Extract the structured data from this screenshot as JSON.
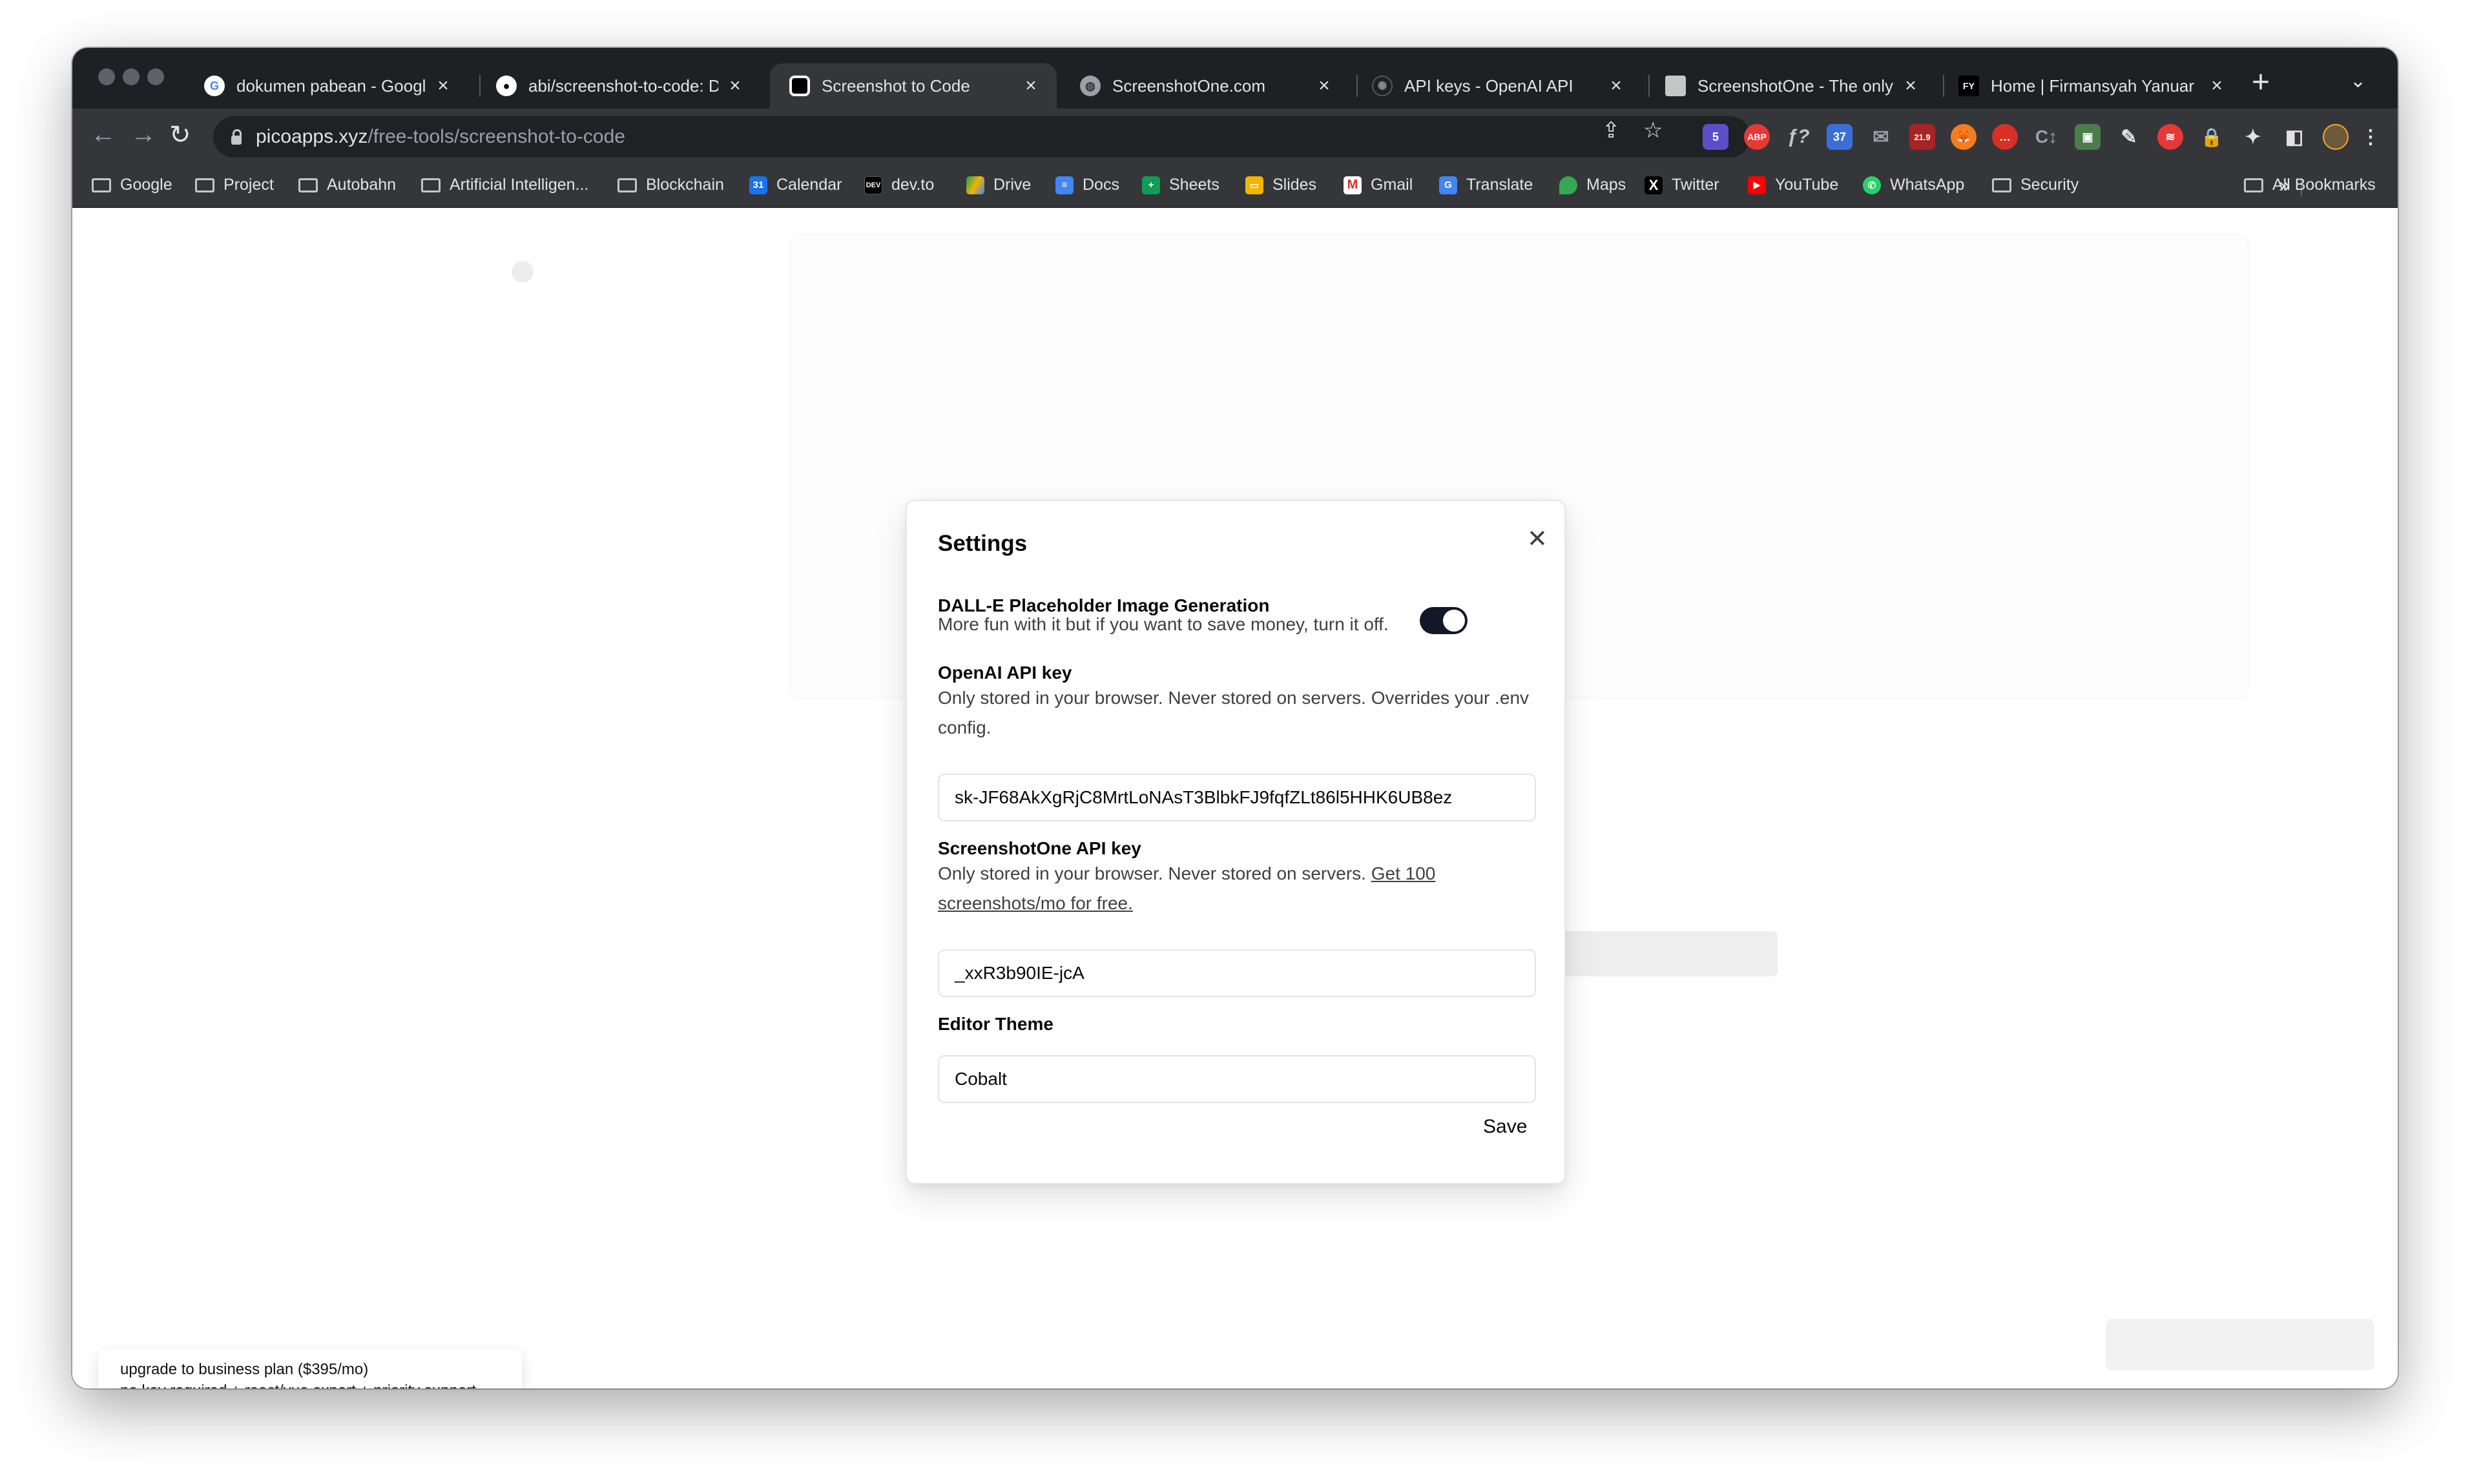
{
  "browser": {
    "tabs": [
      {
        "title": "dokumen pabean - Google S",
        "icon": "google-icon",
        "active": false
      },
      {
        "title": "abi/screenshot-to-code: Dr",
        "icon": "github-icon",
        "active": false
      },
      {
        "title": "Screenshot to Code",
        "icon": "app-icon",
        "active": true
      },
      {
        "title": "ScreenshotOne.com",
        "icon": "globe-icon",
        "active": false
      },
      {
        "title": "API keys - OpenAI API",
        "icon": "openai-icon",
        "active": false
      },
      {
        "title": "ScreenshotOne - The only c",
        "icon": "document-icon",
        "active": false
      },
      {
        "title": "Home | Firmansyah Yanuar",
        "icon": "fy-icon",
        "active": false
      }
    ],
    "url_host": "picoapps.xyz",
    "url_path": "/free-tools/screenshot-to-code",
    "extension_badges": {
      "ext1": "5",
      "abp": "ABP",
      "ext3": "37",
      "calendar": "21.9"
    }
  },
  "bookmarks": [
    {
      "label": "Google",
      "icon": "folder-icon"
    },
    {
      "label": "Project",
      "icon": "folder-icon"
    },
    {
      "label": "Autobahn",
      "icon": "folder-icon"
    },
    {
      "label": "Artificial Intelligen...",
      "icon": "folder-icon"
    },
    {
      "label": "Blockchain",
      "icon": "folder-icon"
    },
    {
      "label": "Calendar",
      "icon": "calendar-icon"
    },
    {
      "label": "dev.to",
      "icon": "dev-icon"
    },
    {
      "label": "Drive",
      "icon": "drive-icon"
    },
    {
      "label": "Docs",
      "icon": "docs-icon"
    },
    {
      "label": "Sheets",
      "icon": "sheets-icon"
    },
    {
      "label": "Slides",
      "icon": "slides-icon"
    },
    {
      "label": "Gmail",
      "icon": "gmail-icon"
    },
    {
      "label": "Translate",
      "icon": "translate-icon"
    },
    {
      "label": "Maps",
      "icon": "maps-icon"
    },
    {
      "label": "Twitter",
      "icon": "x-icon"
    },
    {
      "label": "YouTube",
      "icon": "youtube-icon"
    },
    {
      "label": "WhatsApp",
      "icon": "whatsapp-icon"
    },
    {
      "label": "Security",
      "icon": "folder-icon"
    }
  ],
  "bookmarks_overflow": "»",
  "all_bookmarks": "All Bookmarks",
  "settings": {
    "title": "Settings",
    "dalle_label": "DALL-E Placeholder Image Generation",
    "dalle_desc": "More fun with it but if you want to save money, turn it off.",
    "dalle_enabled": true,
    "openai_label": "OpenAI API key",
    "openai_desc": "Only stored in your browser. Never stored on servers. Overrides your .env config.",
    "openai_value": "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",
    "screenshotone_label": "ScreenshotOne API key",
    "screenshotone_desc": "Only stored in your browser. Never stored on servers.",
    "screenshotone_link": "Get 100 screenshots/mo for free.",
    "screenshotone_value": "_xxR3b90IE-jcA",
    "theme_label": "Editor Theme",
    "theme_value": "Cobalt",
    "save_label": "Save"
  },
  "banner": {
    "line1": "upgrade to business plan ($395/mo)",
    "line2": "no key required + react/vue export + priority support"
  },
  "colors": {
    "accent": "#111827",
    "chrome_dark": "#1f2023",
    "chrome_toolbar": "#35363a"
  }
}
